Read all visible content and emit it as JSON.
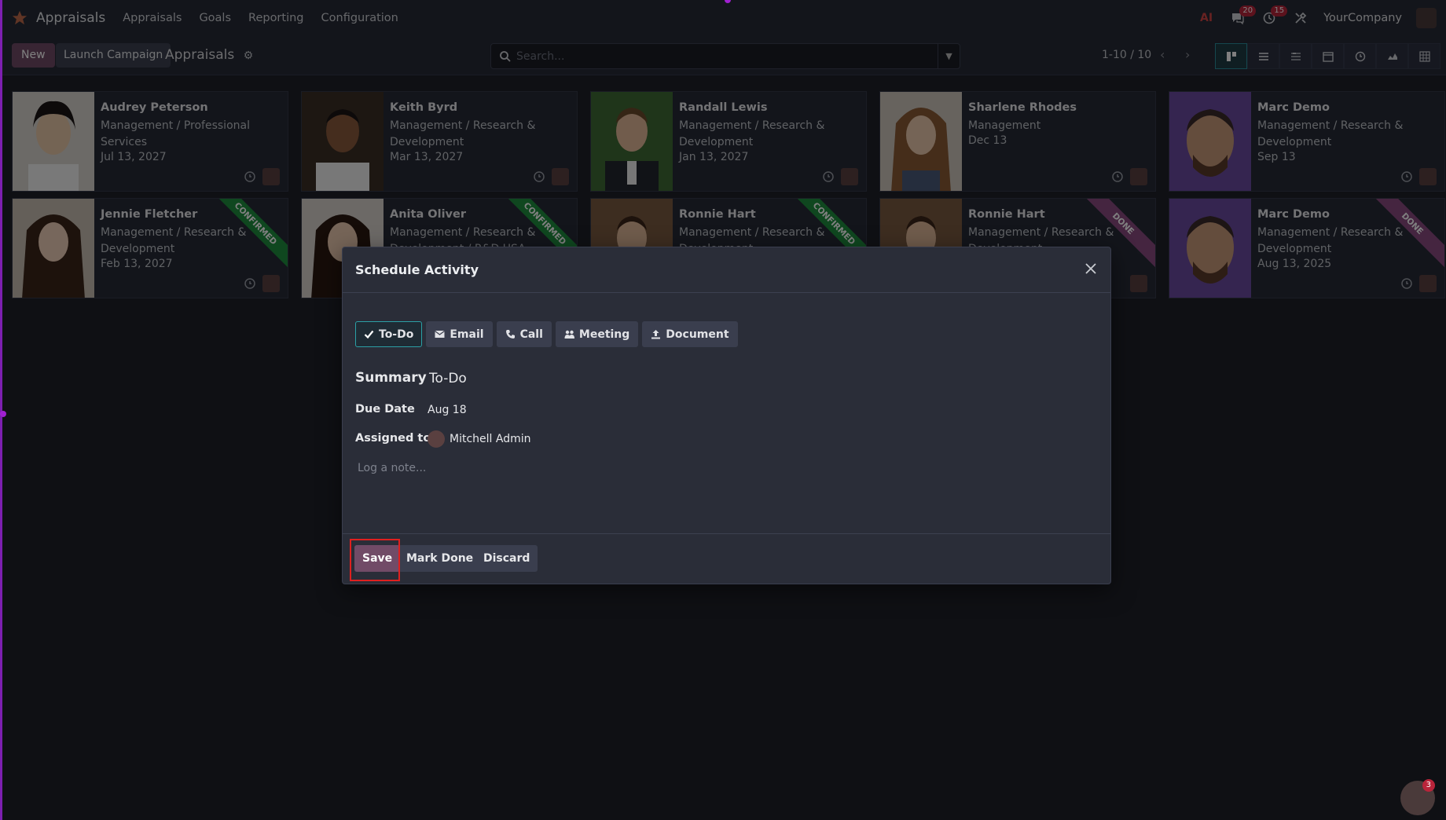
{
  "navbar": {
    "brand": "Appraisals",
    "menu": [
      "Appraisals",
      "Goals",
      "Reporting",
      "Configuration"
    ],
    "messages_badge": "20",
    "activities_badge": "15",
    "company": "YourCompany"
  },
  "control": {
    "new_label": "New",
    "campaign_label": "Launch Campaign",
    "title": "Appraisals",
    "search_placeholder": "Search...",
    "pager": "1-10 / 10"
  },
  "cards": [
    {
      "name": "Audrey Peterson",
      "dept": "Management / Professional Services",
      "date": "Jul 13, 2027",
      "ribbon": ""
    },
    {
      "name": "Keith Byrd",
      "dept": "Management / Research & Development",
      "date": "Mar 13, 2027",
      "ribbon": ""
    },
    {
      "name": "Randall Lewis",
      "dept": "Management / Research & Development",
      "date": "Jan 13, 2027",
      "ribbon": ""
    },
    {
      "name": "Sharlene Rhodes",
      "dept": "Management",
      "date": "Dec 13",
      "ribbon": ""
    },
    {
      "name": "Marc Demo",
      "dept": "Management / Research & Development",
      "date": "Sep 13",
      "ribbon": ""
    },
    {
      "name": "Jennie Fletcher",
      "dept": "Management / Research & Development",
      "date": "Feb 13, 2027",
      "ribbon": "CONFIRMED"
    },
    {
      "name": "Anita Oliver",
      "dept": "Management / Research & Development / R&D USA",
      "date": "",
      "ribbon": "CONFIRMED"
    },
    {
      "name": "Ronnie Hart",
      "dept": "Management / Research & Development",
      "date": "",
      "ribbon": "CONFIRMED"
    },
    {
      "name": "Ronnie Hart",
      "dept": "Management / Research & Development",
      "date": "",
      "ribbon": "DONE"
    },
    {
      "name": "Marc Demo",
      "dept": "Management / Research & Development",
      "date": "Aug 13, 2025",
      "ribbon": "DONE"
    }
  ],
  "modal": {
    "title": "Schedule Activity",
    "types": [
      "To-Do",
      "Email",
      "Call",
      "Meeting",
      "Document"
    ],
    "summary_label": "Summary",
    "summary_value": "To-Do",
    "due_label": "Due Date",
    "due_value": "Aug 18",
    "assigned_label": "Assigned to",
    "assigned_value": "Mitchell Admin",
    "note_placeholder": "Log a note...",
    "save_label": "Save",
    "mark_done_label": "Mark Done",
    "discard_label": "Discard"
  },
  "chat_badge": "3",
  "colors": {
    "brand_primary": "#714b67",
    "confirmed_ribbon": "#1e8e3e",
    "done_ribbon": "#8a4a80",
    "highlight": "#e0201f"
  }
}
